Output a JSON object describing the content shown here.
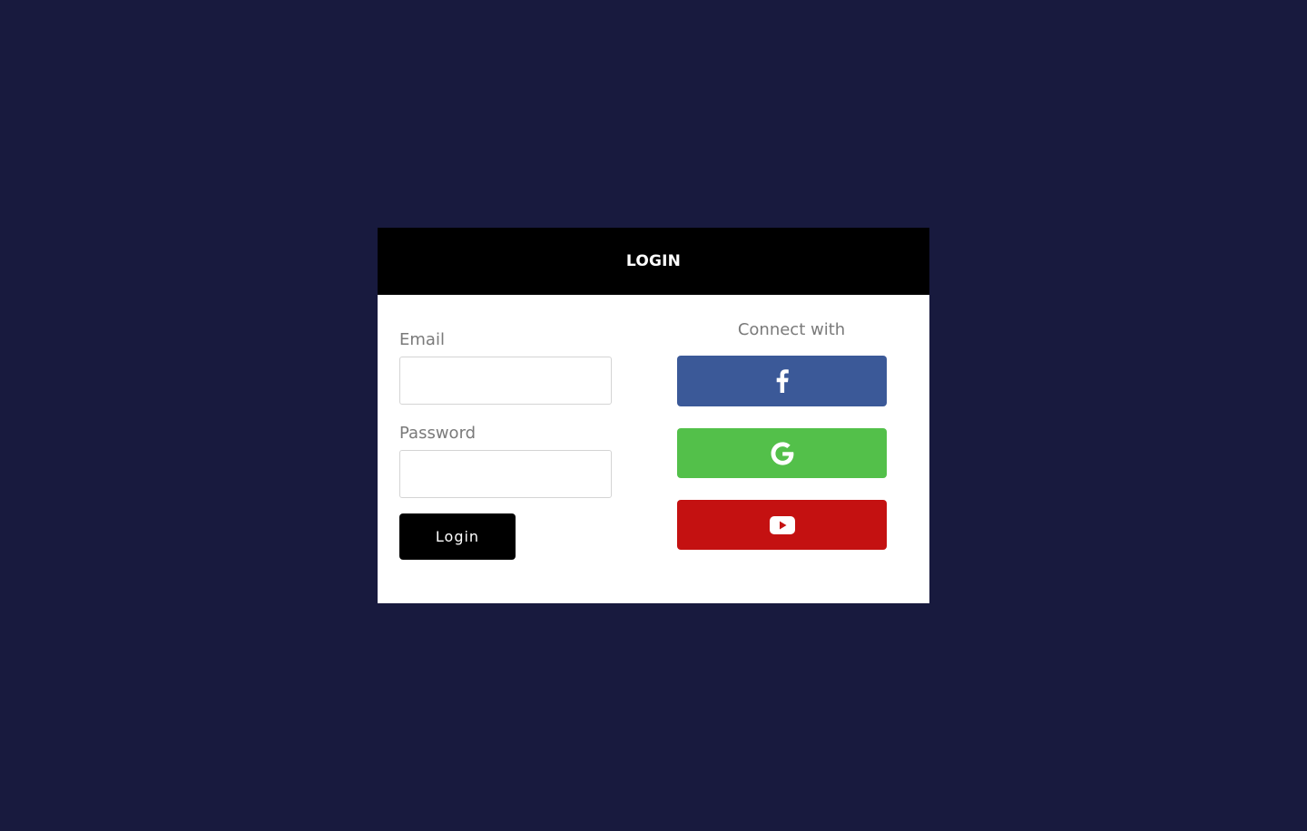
{
  "header": {
    "title": "LOGIN"
  },
  "form": {
    "email_label": "Email",
    "email_value": "",
    "password_label": "Password",
    "password_value": "",
    "login_label": "Login"
  },
  "social": {
    "heading": "Connect with",
    "buttons": [
      {
        "name": "facebook",
        "icon": "facebook-icon",
        "color": "#3b5998"
      },
      {
        "name": "google",
        "icon": "google-icon",
        "color": "#53c04a"
      },
      {
        "name": "youtube",
        "icon": "youtube-icon",
        "color": "#c41111"
      }
    ]
  },
  "colors": {
    "background": "#181a3e",
    "header": "#000000",
    "card": "#ffffff",
    "label": "#7a7a7a"
  }
}
